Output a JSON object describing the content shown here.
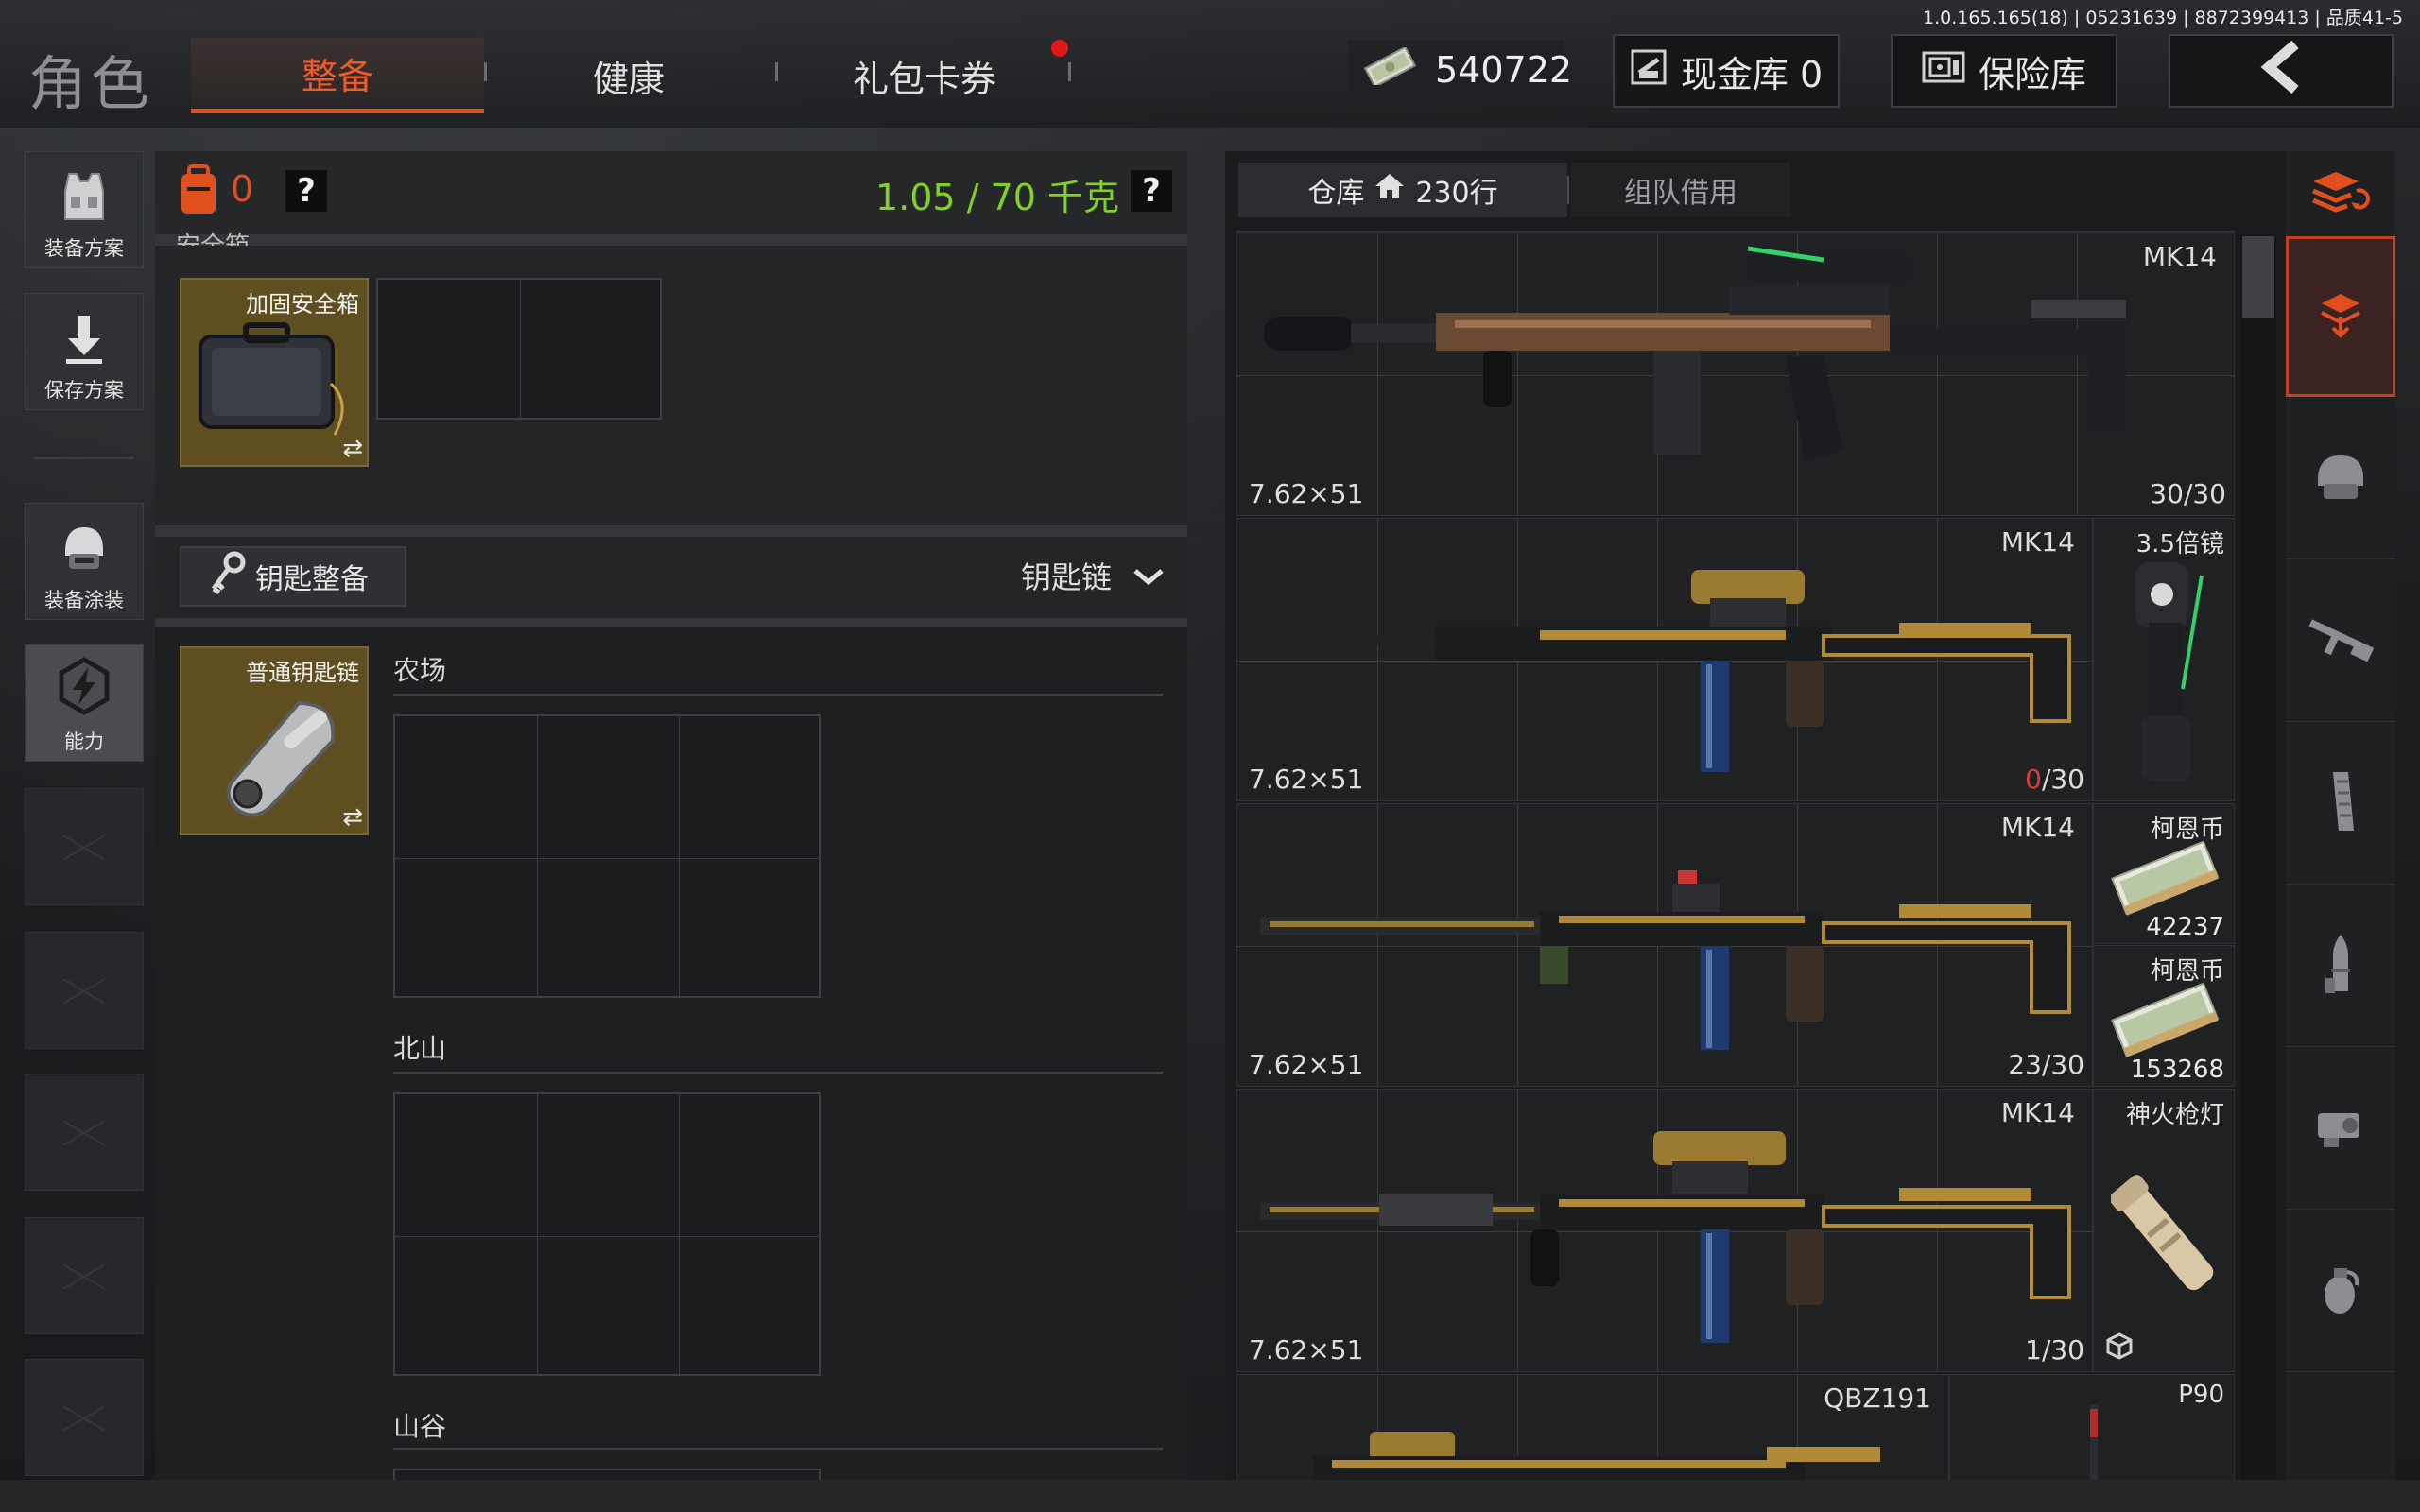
{
  "header": {
    "version": "1.0.165.165(18) | 05231639 | 8872399413 | 品质41-5",
    "title": "角色",
    "tabs": [
      {
        "label": "整备",
        "active": true
      },
      {
        "label": "健康",
        "active": false
      },
      {
        "label": "礼包卡券",
        "active": false,
        "notification": true
      }
    ],
    "money_value": "540722",
    "cash_vault_label": "现金库 0",
    "safe_label": "保险库",
    "back_icon": "chevron-left-icon"
  },
  "left_nav": {
    "items": [
      {
        "label": "装备方案",
        "icon": "vest-icon"
      },
      {
        "label": "保存方案",
        "icon": "download-icon"
      },
      {
        "label": "装备涂装",
        "icon": "helmet-icon"
      },
      {
        "label": "能力",
        "icon": "lightning-hex-icon"
      }
    ]
  },
  "middle": {
    "backpack_count": "0",
    "weight": "1.05 / 70 千克",
    "help_label": "?",
    "secure_case_header": "安全箱",
    "secure_case_item": "加固安全箱",
    "swap_symbol": "⇄",
    "key_section_button": "钥匙整备",
    "key_dropdown": "钥匙链",
    "key_item": "普通钥匙链",
    "maps": [
      "农场",
      "北山",
      "山谷"
    ]
  },
  "warehouse": {
    "tab_warehouse": "仓库",
    "tab_rows": "230行",
    "tab_team": "组队借用",
    "rows": [
      {
        "name": "MK14",
        "caliber": "7.62×51",
        "ammo_loaded": "30",
        "ammo_sep_cap": "/30",
        "ammo_color": "#dcdcdc"
      },
      {
        "name": "MK14",
        "caliber": "7.62×51",
        "ammo_loaded": "0",
        "ammo_sep_cap": "/30",
        "ammo_color": "#e03a3a",
        "side_label": "3.5倍镜"
      },
      {
        "name": "MK14",
        "caliber": "7.62×51",
        "ammo_loaded": "23",
        "ammo_sep_cap": "/30",
        "ammo_color": "#dcdcdc",
        "side_items": [
          {
            "label": "柯恩币",
            "value": "42237"
          },
          {
            "label": "柯恩币",
            "value": "153268"
          }
        ]
      },
      {
        "name": "MK14",
        "caliber": "7.62×51",
        "ammo_loaded": "1",
        "ammo_sep_cap": "/30",
        "ammo_color": "#dcdcdc",
        "side_label": "神火枪灯"
      },
      {
        "name": "QBZ191",
        "side_label": "P90"
      }
    ]
  },
  "rail": {
    "icons": [
      "sort-icon",
      "backpack-stack-icon",
      "helmet-icon",
      "rifle-icon",
      "magazine-icon",
      "bullet-icon",
      "scope-icon",
      "grenade-icon"
    ]
  },
  "colors": {
    "accent_orange": "#e0501e",
    "weight_green": "#7ed321",
    "gold_tile": "#5e4e20"
  }
}
